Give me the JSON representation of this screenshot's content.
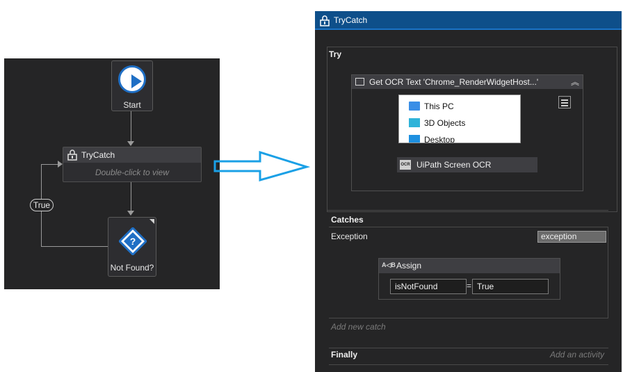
{
  "flowchart": {
    "start_label": "Start",
    "trycatch_title": "TryCatch",
    "trycatch_hint": "Double-click to view",
    "decision_label": "Not Found?",
    "true_label": "True"
  },
  "trycatch_panel": {
    "title": "TryCatch",
    "try_label": "Try",
    "ocr_activity_title": "Get OCR Text 'Chrome_RenderWidgetHost...'",
    "preview_items": [
      "This PC",
      "3D Objects",
      "Desktop"
    ],
    "ocr_engine_title": "UiPath Screen OCR",
    "catches_label": "Catches",
    "exception_type": "Exception",
    "exception_var": "exception",
    "assign_title": "Assign",
    "assign_to": "isNotFound",
    "assign_eq": "=",
    "assign_value": "True",
    "add_catch_hint": "Add new catch",
    "finally_label": "Finally",
    "finally_hint": "Add an activity"
  },
  "colors": {
    "canvas": "#252526",
    "node": "#2d2d30",
    "header": "#3e3e42",
    "title_bar": "#0e4f8a",
    "accent_blue": "#1f6fc5",
    "arrow_blue": "#1aa0e6"
  },
  "icons": {
    "trycatch": "trycatch-lock-icon",
    "start": "play-icon",
    "decision": "question-diamond-icon",
    "ocr": "screen-icon",
    "assign": "assign-ab-icon",
    "collapse": "double-chevron-up-icon",
    "menu": "hamburger-icon"
  }
}
